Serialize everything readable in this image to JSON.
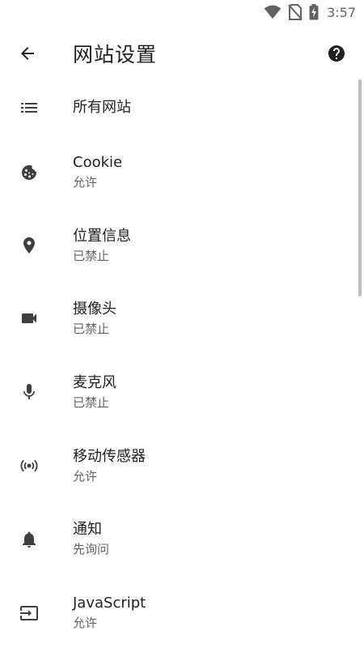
{
  "status_bar": {
    "time": "3:57",
    "icons": [
      "wifi-icon",
      "no-sim-icon",
      "battery-charging-icon"
    ]
  },
  "app_bar": {
    "title": "网站设置",
    "back_icon": "arrow-back-icon",
    "help_icon": "help-icon"
  },
  "settings": {
    "items": [
      {
        "title": "所有网站",
        "subtitle": "",
        "icon": "list-icon"
      },
      {
        "title": "Cookie",
        "subtitle": "允许",
        "icon": "cookie-icon"
      },
      {
        "title": "位置信息",
        "subtitle": "已禁止",
        "icon": "location-pin-icon"
      },
      {
        "title": "摄像头",
        "subtitle": "已禁止",
        "icon": "videocam-icon"
      },
      {
        "title": "麦克风",
        "subtitle": "已禁止",
        "icon": "microphone-icon"
      },
      {
        "title": "移动传感器",
        "subtitle": "允许",
        "icon": "sensors-icon"
      },
      {
        "title": "通知",
        "subtitle": "先询问",
        "icon": "bell-icon"
      },
      {
        "title": "JavaScript",
        "subtitle": "允许",
        "icon": "javascript-icon"
      }
    ]
  },
  "colors": {
    "text_primary": "#202124",
    "text_secondary": "#5f6368",
    "icon": "#3c4043",
    "scrollbar": "#bdbdbd"
  }
}
